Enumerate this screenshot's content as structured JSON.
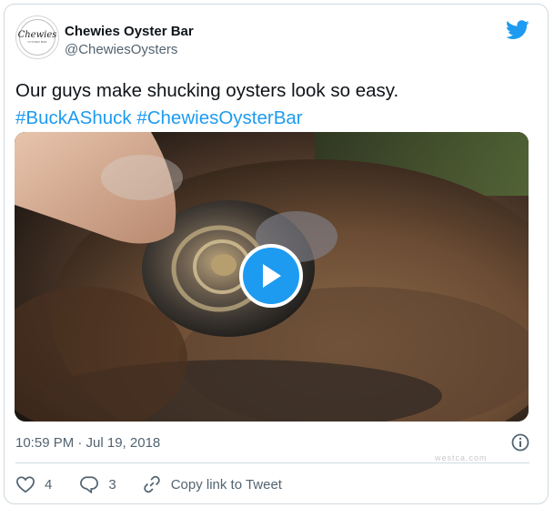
{
  "account": {
    "display_name": "Chewies Oyster Bar",
    "handle": "@ChewiesOysters",
    "avatar_text": "Chewies",
    "avatar_subtext": "OYSTER BAR"
  },
  "tweet": {
    "text": "Our guys make shucking oysters look so easy.",
    "hashtags": [
      "#BuckAShuck",
      "#ChewiesOysterBar"
    ],
    "timestamp": "10:59 PM · Jul 19, 2018"
  },
  "actions": {
    "like_count": "4",
    "reply_count": "3",
    "copy_link_label": "Copy link to Tweet"
  },
  "watermark": "westca.com",
  "colors": {
    "twitter_blue": "#1d9bf0",
    "text": "#0f1419",
    "secondary": "#536471",
    "border": "#cfd9de"
  },
  "icons": [
    "twitter-bird-icon",
    "play-icon",
    "info-icon",
    "heart-icon",
    "reply-icon",
    "link-icon"
  ]
}
